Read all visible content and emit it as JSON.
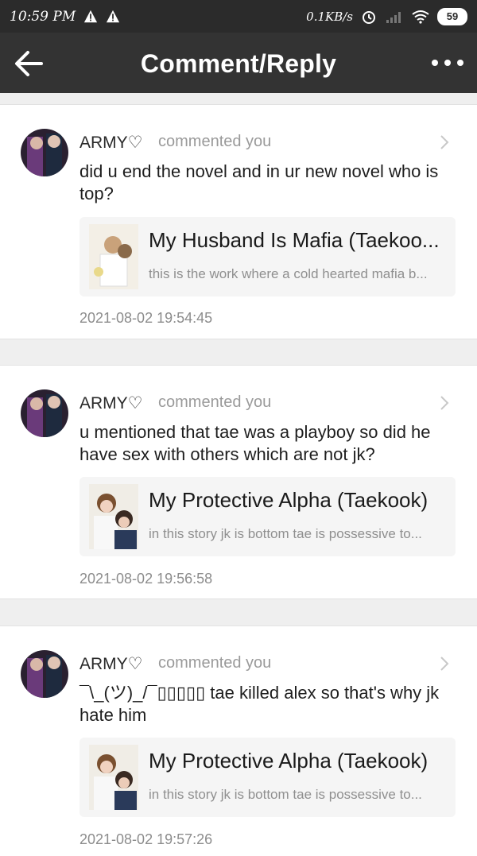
{
  "status_bar": {
    "time": "10:59 PM",
    "network_speed": "0.1KB/s",
    "battery": "59"
  },
  "header": {
    "title": "Comment/Reply"
  },
  "comments": [
    {
      "user": "ARMY♡",
      "action": "commented you",
      "text": "did u end the novel and in ur new novel who is top?",
      "work_title": "My Husband Is Mafia (Taekoo...",
      "work_desc": "this is the work where a cold hearted mafia b...",
      "timestamp": "2021-08-02 19:54:45"
    },
    {
      "user": "ARMY♡",
      "action": "commented you",
      "text": "u mentioned that tae was a playboy so did he have sex with others which are not jk?",
      "work_title": "My Protective Alpha (Taekook)",
      "work_desc": "in this story jk is bottom tae is possessive to...",
      "timestamp": "2021-08-02 19:56:58"
    },
    {
      "user": "ARMY♡",
      "action": "commented you",
      "text": "¯\\_(ツ)_/¯▯▯▯▯▯ tae killed alex so that's why jk hate him",
      "work_title": "My Protective Alpha (Taekook)",
      "work_desc": "in this story jk is bottom tae is possessive to...",
      "timestamp": "2021-08-02 19:57:26"
    }
  ]
}
